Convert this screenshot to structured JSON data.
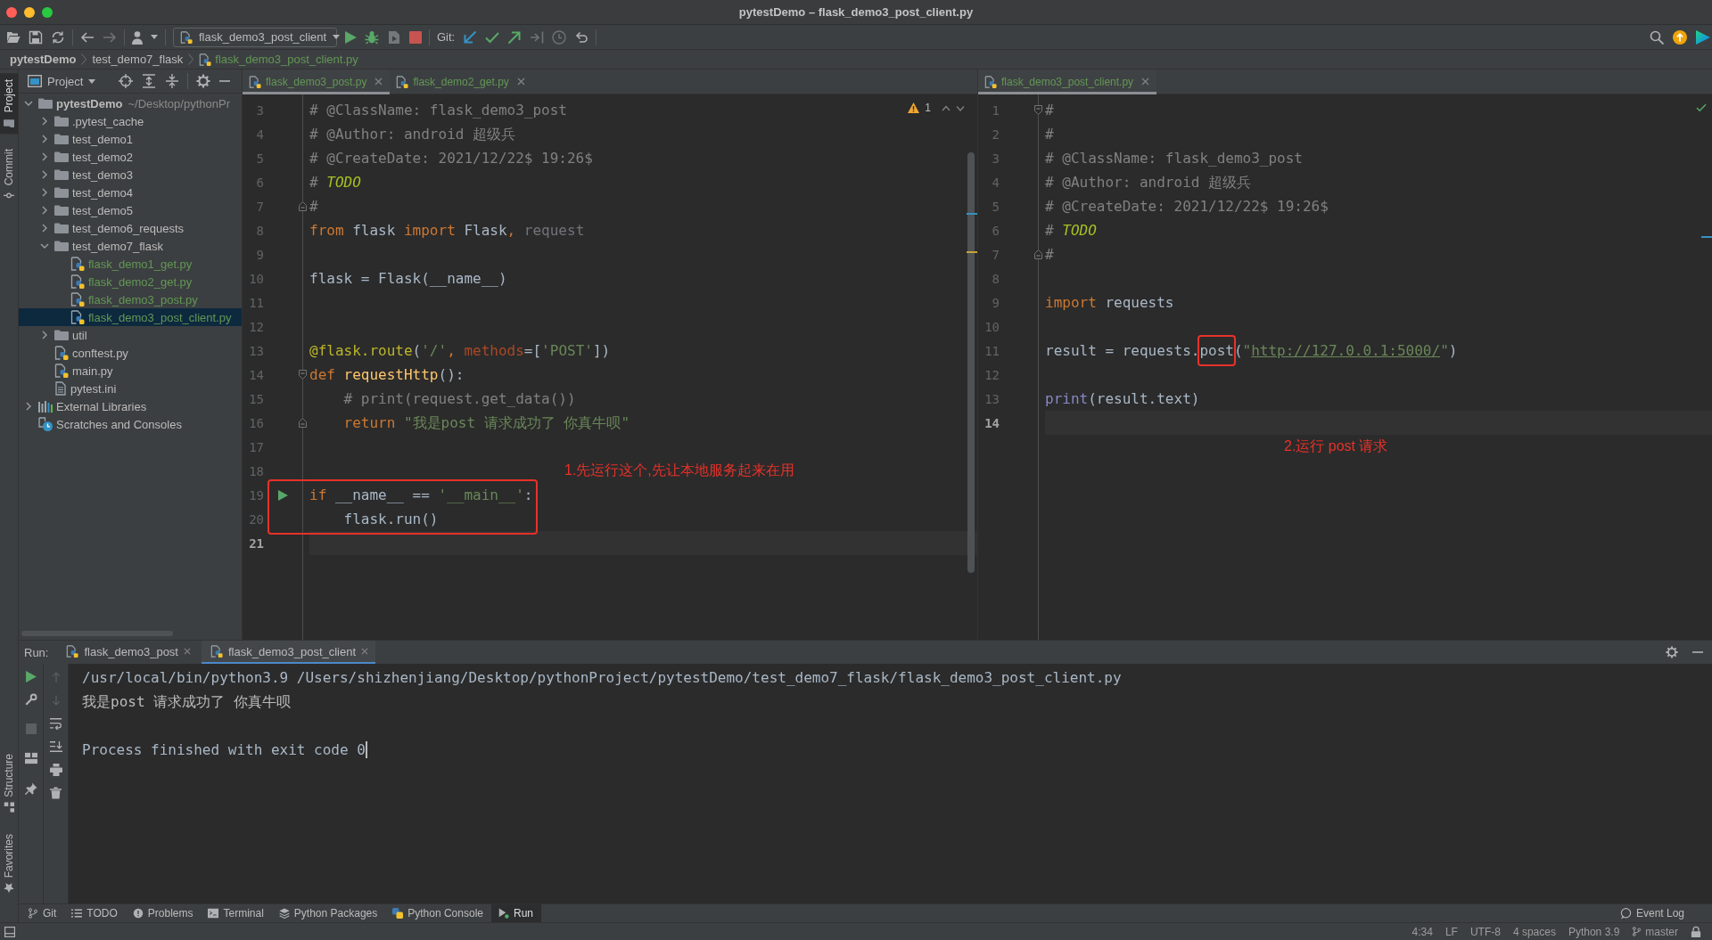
{
  "window": {
    "title": "pytestDemo – flask_demo3_post_client.py"
  },
  "toolbar": {
    "run_configuration": "flask_demo3_post_client",
    "git_label": "Git:"
  },
  "breadcrumbs": [
    {
      "label": "pytestDemo",
      "kind": "project"
    },
    {
      "label": "test_demo7_flask",
      "kind": "folder"
    },
    {
      "label": "flask_demo3_post_client.py",
      "kind": "file"
    }
  ],
  "left_strip": {
    "top": [
      {
        "label": "Project",
        "selected": true
      },
      {
        "label": "Commit",
        "selected": false
      }
    ],
    "bottom": [
      {
        "label": "Structure",
        "selected": false
      },
      {
        "label": "Favorites",
        "selected": false
      }
    ]
  },
  "project_panel": {
    "title": "Project",
    "tree": [
      {
        "label": "pytestDemo",
        "hint": "~/Desktop/pythonPr",
        "kind": "project",
        "expanded": true,
        "selected": false,
        "added": false,
        "children": [
          {
            "label": ".pytest_cache",
            "kind": "folder",
            "expanded": false,
            "selected": false,
            "added": false
          },
          {
            "label": "test_demo1",
            "kind": "folder",
            "expanded": false,
            "selected": false,
            "added": false
          },
          {
            "label": "test_demo2",
            "kind": "folder",
            "expanded": false,
            "selected": false,
            "added": false
          },
          {
            "label": "test_demo3",
            "kind": "folder",
            "expanded": false,
            "selected": false,
            "added": false
          },
          {
            "label": "test_demo4",
            "kind": "folder",
            "expanded": false,
            "selected": false,
            "added": false
          },
          {
            "label": "test_demo5",
            "kind": "folder",
            "expanded": false,
            "selected": false,
            "added": false
          },
          {
            "label": "test_demo6_requests",
            "kind": "folder",
            "expanded": false,
            "selected": false,
            "added": false
          },
          {
            "label": "test_demo7_flask",
            "kind": "folder",
            "expanded": true,
            "selected": false,
            "added": false,
            "children": [
              {
                "label": "flask_demo1_get.py",
                "kind": "python",
                "selected": false,
                "added": true
              },
              {
                "label": "flask_demo2_get.py",
                "kind": "python",
                "selected": false,
                "added": true
              },
              {
                "label": "flask_demo3_post.py",
                "kind": "python",
                "selected": false,
                "added": true
              },
              {
                "label": "flask_demo3_post_client.py",
                "kind": "python",
                "selected": true,
                "added": true
              }
            ]
          },
          {
            "label": "util",
            "kind": "folder",
            "expanded": false,
            "selected": false,
            "added": false
          },
          {
            "label": "conftest.py",
            "kind": "python",
            "selected": false,
            "added": false
          },
          {
            "label": "main.py",
            "kind": "python",
            "selected": false,
            "added": false
          },
          {
            "label": "pytest.ini",
            "kind": "text",
            "selected": false,
            "added": false
          }
        ]
      },
      {
        "label": "External Libraries",
        "kind": "libraries",
        "expanded": false,
        "selected": false,
        "added": false
      },
      {
        "label": "Scratches and Consoles",
        "kind": "scratches",
        "selected": false,
        "added": false
      }
    ]
  },
  "editors": [
    {
      "tabs": [
        {
          "label": "flask_demo3_post.py",
          "selected": true,
          "added": true
        },
        {
          "label": "flask_demo2_get.py",
          "selected": false,
          "added": true
        }
      ],
      "inspection": {
        "kind": "warning",
        "count": "1"
      },
      "lines": [
        {
          "number": "3",
          "current": false,
          "boxed": false,
          "tokens": [
            {
              "kind": "comment",
              "text": "# @ClassName: flask_demo3_post"
            }
          ]
        },
        {
          "number": "4",
          "current": false,
          "boxed": false,
          "tokens": [
            {
              "kind": "comment",
              "text": "# @Author: android 超级兵"
            }
          ]
        },
        {
          "number": "5",
          "current": false,
          "boxed": false,
          "tokens": [
            {
              "kind": "comment",
              "text": "# @CreateDate: 2021/12/22$ 19:26$"
            }
          ]
        },
        {
          "number": "6",
          "current": false,
          "boxed": false,
          "tokens": [
            {
              "kind": "comment",
              "text": "# "
            },
            {
              "kind": "todo",
              "text": "TODO"
            }
          ]
        },
        {
          "number": "7",
          "current": false,
          "boxed": false,
          "gutter": {
            "kind": "fold-end"
          },
          "tokens": [
            {
              "kind": "comment",
              "text": "#"
            }
          ]
        },
        {
          "number": "8",
          "current": false,
          "boxed": false,
          "tokens": [
            {
              "kind": "keyword",
              "text": "from"
            },
            {
              "kind": "plain",
              "text": " flask "
            },
            {
              "kind": "keyword",
              "text": "import"
            },
            {
              "kind": "plain",
              "text": " Flask"
            },
            {
              "kind": "keyword",
              "text": ","
            },
            {
              "kind": "unused",
              "text": " request"
            }
          ]
        },
        {
          "number": "9",
          "current": false,
          "boxed": false
        },
        {
          "number": "10",
          "current": false,
          "boxed": false,
          "tokens": [
            {
              "kind": "plain",
              "text": "flask = Flask(__name__)"
            }
          ]
        },
        {
          "number": "11",
          "current": false,
          "boxed": false
        },
        {
          "number": "12",
          "current": false,
          "boxed": false
        },
        {
          "number": "13",
          "current": false,
          "boxed": false,
          "tokens": [
            {
              "kind": "decorator",
              "text": "@flask.route"
            },
            {
              "kind": "plain",
              "text": "("
            },
            {
              "kind": "string",
              "text": "'/'"
            },
            {
              "kind": "keyword",
              "text": ", "
            },
            {
              "kind": "param",
              "text": "methods"
            },
            {
              "kind": "plain",
              "text": "=["
            },
            {
              "kind": "string",
              "text": "'POST'"
            },
            {
              "kind": "plain",
              "text": "])"
            }
          ]
        },
        {
          "number": "14",
          "current": false,
          "boxed": false,
          "gutter": {
            "kind": "fold-start"
          },
          "tokens": [
            {
              "kind": "keyword",
              "text": "def "
            },
            {
              "kind": "function",
              "text": "requestHttp"
            },
            {
              "kind": "plain",
              "text": "():"
            }
          ]
        },
        {
          "number": "15",
          "current": false,
          "boxed": false,
          "tokens": [
            {
              "kind": "comment",
              "text": "    # print(request.get_data())"
            }
          ]
        },
        {
          "number": "16",
          "current": false,
          "boxed": false,
          "gutter": {
            "kind": "fold-end"
          },
          "tokens": [
            {
              "kind": "keyword",
              "text": "    return "
            },
            {
              "kind": "string",
              "text": "\"我是post 请求成功了 你真牛呗\""
            }
          ]
        },
        {
          "number": "17",
          "current": false,
          "boxed": false
        },
        {
          "number": "18",
          "current": false,
          "boxed": false,
          "note": "1.先运行这个,先让本地服务起来在用"
        },
        {
          "number": "19",
          "current": false,
          "boxed": true,
          "gutter": {
            "kind": "run"
          },
          "tokens": [
            {
              "kind": "keyword",
              "text": "if"
            },
            {
              "kind": "plain",
              "text": " __name__ == "
            },
            {
              "kind": "string",
              "text": "'__main__'"
            },
            {
              "kind": "plain",
              "text": ":"
            }
          ]
        },
        {
          "number": "20",
          "current": false,
          "boxed": true,
          "tokens": [
            {
              "kind": "plain",
              "text": "    flask.run()"
            }
          ]
        },
        {
          "number": "21",
          "current": true,
          "boxed": false
        }
      ]
    },
    {
      "tabs": [
        {
          "label": "flask_demo3_post_client.py",
          "selected": true,
          "added": true
        }
      ],
      "inspection": {
        "kind": "ok"
      },
      "lines": [
        {
          "number": "1",
          "current": false,
          "boxed": false,
          "gutter": {
            "kind": "fold-start"
          },
          "tokens": [
            {
              "kind": "comment",
              "text": "#"
            }
          ]
        },
        {
          "number": "2",
          "current": false,
          "boxed": false,
          "tokens": [
            {
              "kind": "comment",
              "text": "#"
            }
          ]
        },
        {
          "number": "3",
          "current": false,
          "boxed": false,
          "tokens": [
            {
              "kind": "comment",
              "text": "# @ClassName: flask_demo3_post"
            }
          ]
        },
        {
          "number": "4",
          "current": false,
          "boxed": false,
          "tokens": [
            {
              "kind": "comment",
              "text": "# @Author: android 超级兵"
            }
          ]
        },
        {
          "number": "5",
          "current": false,
          "boxed": false,
          "tokens": [
            {
              "kind": "comment",
              "text": "# @CreateDate: 2021/12/22$ 19:26$"
            }
          ]
        },
        {
          "number": "6",
          "current": false,
          "boxed": false,
          "tokens": [
            {
              "kind": "comment",
              "text": "# "
            },
            {
              "kind": "todo",
              "text": "TODO"
            }
          ]
        },
        {
          "number": "7",
          "current": false,
          "boxed": false,
          "gutter": {
            "kind": "fold-end"
          },
          "tokens": [
            {
              "kind": "comment",
              "text": "#"
            }
          ]
        },
        {
          "number": "8",
          "current": false,
          "boxed": false
        },
        {
          "number": "9",
          "current": false,
          "boxed": false,
          "tokens": [
            {
              "kind": "keyword",
              "text": "import"
            },
            {
              "kind": "plain",
              "text": " requests"
            }
          ]
        },
        {
          "number": "10",
          "current": false,
          "boxed": false
        },
        {
          "number": "11",
          "current": false,
          "boxed": false,
          "tokens": [
            {
              "kind": "plain",
              "text": "result = requests."
            },
            {
              "kind": "plain",
              "text": "post",
              "boxed": true
            },
            {
              "kind": "plain",
              "text": "("
            },
            {
              "kind": "string",
              "text": "\""
            },
            {
              "kind": "url",
              "text": "http://127.0.0.1:5000/"
            },
            {
              "kind": "string",
              "text": "\""
            },
            {
              "kind": "plain",
              "text": ")"
            }
          ]
        },
        {
          "number": "12",
          "current": false,
          "boxed": false
        },
        {
          "number": "13",
          "current": false,
          "boxed": false,
          "tokens": [
            {
              "kind": "builtin",
              "text": "print"
            },
            {
              "kind": "plain",
              "text": "(result.text)"
            }
          ]
        },
        {
          "number": "14",
          "current": true,
          "boxed": false
        }
      ],
      "note": "2.运行 post 请求"
    }
  ],
  "run_panel": {
    "label": "Run:",
    "tabs": [
      {
        "label": "flask_demo3_post",
        "selected": false
      },
      {
        "label": "flask_demo3_post_client",
        "selected": true
      }
    ],
    "console": [
      {
        "kind": "command",
        "text": "/usr/local/bin/python3.9 /Users/shizhenjiang/Desktop/pythonProject/pytestDemo/test_demo7_flask/flask_demo3_post_client.py"
      },
      {
        "kind": "output",
        "text": "我是post 请求成功了 你真牛呗"
      },
      {
        "kind": "exit",
        "text": "Process finished with exit code 0"
      }
    ]
  },
  "tool_tabs": [
    {
      "label": "Git",
      "selected": false
    },
    {
      "label": "TODO",
      "selected": false
    },
    {
      "label": "Problems",
      "selected": false
    },
    {
      "label": "Terminal",
      "selected": false
    },
    {
      "label": "Python Packages",
      "selected": false
    },
    {
      "label": "Python Console",
      "selected": false
    },
    {
      "label": "Run",
      "selected": true
    }
  ],
  "event_log": "Event Log",
  "status_bar": {
    "items": [
      "4:34",
      "LF",
      "UTF-8",
      "4 spaces",
      "Python 3.9"
    ],
    "branch": "master"
  }
}
